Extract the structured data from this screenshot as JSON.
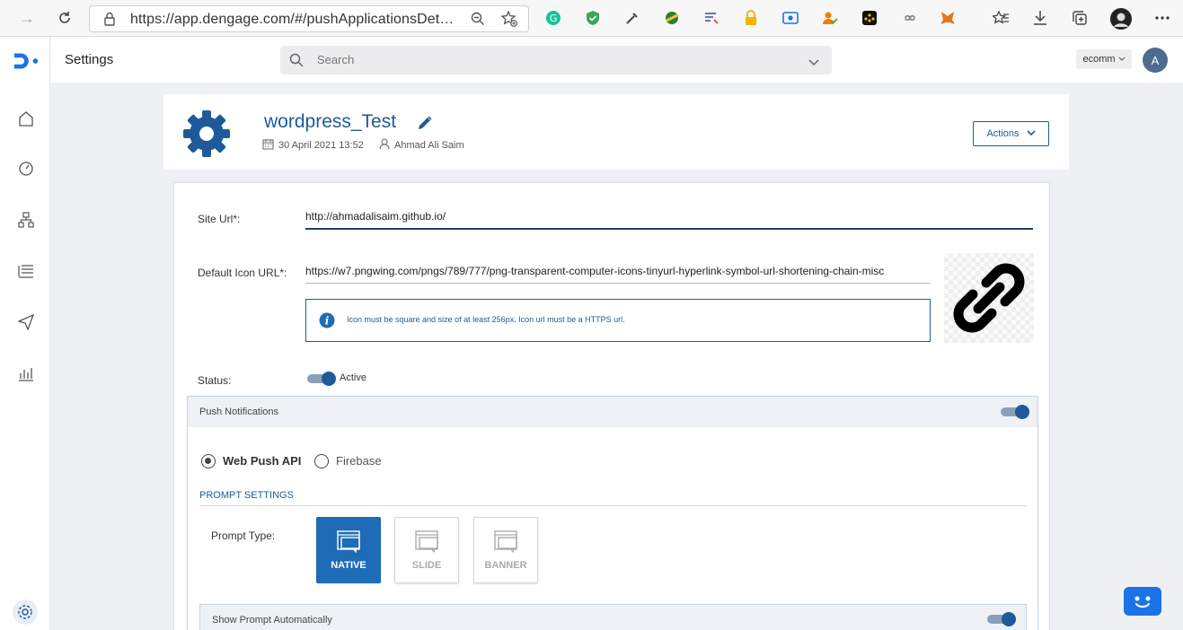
{
  "browser": {
    "url": "https://app.dengage.com/#/pushApplicationsDet…"
  },
  "header": {
    "page_title": "Settings",
    "search_placeholder": "Search",
    "account_label": "ecomm",
    "avatar_initial": "A"
  },
  "app": {
    "name": "wordpress_Test",
    "date": "30 April 2021 13:52",
    "owner": "Ahmad Ali Saim",
    "actions_label": "Actions"
  },
  "form": {
    "site_url_label": "Site Url*:",
    "site_url_value": "http://ahmadalisaim.github.io/",
    "icon_url_label": "Default Icon URL*:",
    "icon_url_value": "https://w7.pngwing.com/pngs/789/777/png-transparent-computer-icons-tinyurl-hyperlink-symbol-url-shortening-chain-misc",
    "icon_info": "Icon must be square and size of at least 256px. Icon url must be a HTTPS url.",
    "status_label": "Status:",
    "status_value": "Active"
  },
  "push": {
    "title": "Push Notifications",
    "option_webpush": "Web Push API",
    "option_firebase": "Firebase",
    "prompt_settings_title": "PROMPT SETTINGS",
    "prompt_type_label": "Prompt Type:",
    "prompt_types": [
      "NATIVE",
      "SLIDE",
      "BANNER"
    ],
    "show_prompt_label": "Show Prompt Automatically"
  },
  "colors": {
    "brand": "#1e5a99",
    "active_card": "#1e6bb8",
    "chat": "#1a73e8"
  }
}
